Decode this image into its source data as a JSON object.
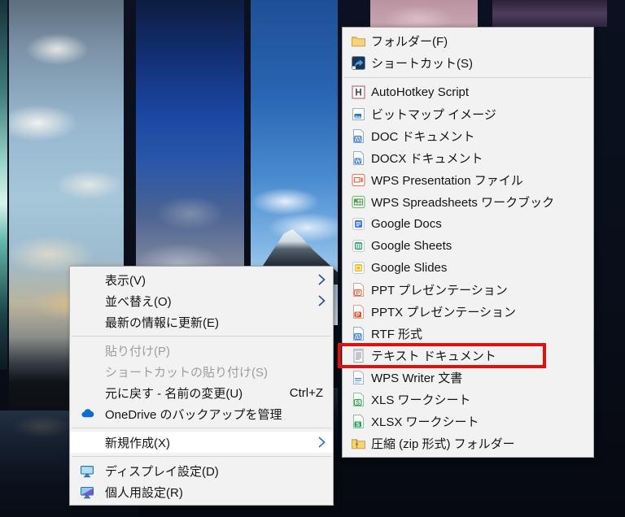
{
  "context_menu": {
    "items": [
      {
        "label": "表示(V)",
        "has_submenu": true
      },
      {
        "label": "並べ替え(O)",
        "has_submenu": true
      },
      {
        "label": "最新の情報に更新(E)"
      },
      {
        "label": "貼り付け(P)",
        "disabled": true
      },
      {
        "label": "ショートカットの貼り付け(S)",
        "disabled": true
      },
      {
        "label": "元に戻す - 名前の変更(U)",
        "shortcut": "Ctrl+Z"
      },
      {
        "label": "OneDrive のバックアップを管理",
        "icon": "onedrive-cloud-icon"
      },
      {
        "label": "新規作成(X)",
        "has_submenu": true,
        "highlighted": true
      },
      {
        "label": "ディスプレイ設定(D)",
        "icon": "display-settings-icon"
      },
      {
        "label": "個人用設定(R)",
        "icon": "personalization-icon"
      }
    ]
  },
  "submenu": {
    "items": [
      {
        "label": "フォルダー(F)",
        "icon": "folder-icon"
      },
      {
        "label": "ショートカット(S)",
        "icon": "shortcut-icon"
      },
      {
        "label": "AutoHotkey Script",
        "icon": "autohotkey-icon"
      },
      {
        "label": "ビットマップ イメージ",
        "icon": "bitmap-image-icon"
      },
      {
        "label": "DOC ドキュメント",
        "icon": "doc-icon"
      },
      {
        "label": "DOCX ドキュメント",
        "icon": "docx-icon"
      },
      {
        "label": "WPS Presentation ファイル",
        "icon": "wps-presentation-icon"
      },
      {
        "label": "WPS Spreadsheets ワークブック",
        "icon": "wps-spreadsheets-icon"
      },
      {
        "label": "Google Docs",
        "icon": "google-docs-icon"
      },
      {
        "label": "Google Sheets",
        "icon": "google-sheets-icon"
      },
      {
        "label": "Google Slides",
        "icon": "google-slides-icon"
      },
      {
        "label": "PPT プレゼンテーション",
        "icon": "ppt-icon"
      },
      {
        "label": "PPTX プレゼンテーション",
        "icon": "pptx-icon"
      },
      {
        "label": "RTF 形式",
        "icon": "rtf-icon"
      },
      {
        "label": "テキスト ドキュメント",
        "icon": "text-document-icon",
        "red_annotation_box": true
      },
      {
        "label": "WPS Writer 文書",
        "icon": "wps-writer-icon"
      },
      {
        "label": "XLS ワークシート",
        "icon": "xls-icon"
      },
      {
        "label": "XLSX ワークシート",
        "icon": "xlsx-icon"
      },
      {
        "label": "圧縮 (zip 形式) フォルダー",
        "icon": "zip-folder-icon"
      }
    ]
  },
  "colors": {
    "menu_background": "#f2f2f2",
    "menu_highlight": "#ffffff",
    "disabled_text": "#9d9d9d",
    "red_annotation_box": "#e01010",
    "submenu_chevron": "#2b4f8e"
  }
}
